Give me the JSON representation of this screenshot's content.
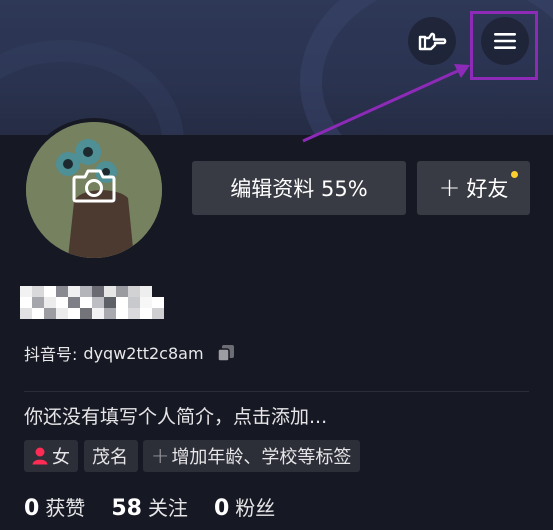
{
  "profile": {
    "edit_button_label": "编辑资料 55%",
    "add_friend_label": "好友",
    "add_friend_plus": "+",
    "douyin_id_label": "抖音号:",
    "douyin_id_value": "dyqw2tt2c8am",
    "bio_placeholder": "你还没有填写个人简介，点击添加...",
    "tags": {
      "gender": "女",
      "name": "茂名",
      "add_plus": "+",
      "add_label": "增加年龄、学校等标签"
    },
    "stats": [
      {
        "count": "0",
        "label": "获赞"
      },
      {
        "count": "58",
        "label": "关注"
      },
      {
        "count": "0",
        "label": "粉丝"
      }
    ]
  },
  "header": {
    "icons": [
      "pointing-hand-icon",
      "menu-icon"
    ]
  },
  "colors": {
    "background": "#161823",
    "button_bg": "#393b44",
    "notification_dot": "#fece2f",
    "gender_icon": "#fe2c55",
    "highlight": "#8e2ab8"
  }
}
